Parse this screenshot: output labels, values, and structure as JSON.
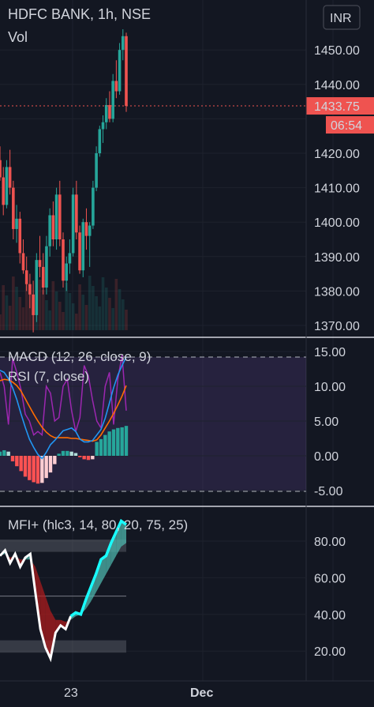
{
  "header": {
    "symbol_line": "HDFC BANK, 1h, NSE",
    "vol_label": "Vol",
    "currency_button": "INR"
  },
  "price_axis": {
    "ticks": [
      "1450.00",
      "1440.00",
      "1430.00",
      "1420.00",
      "1410.00",
      "1400.00",
      "1390.00",
      "1380.00",
      "1370.00"
    ],
    "last_price": "1433.75",
    "countdown": "06:54"
  },
  "macd_pane": {
    "legend_macd": "MACD (12, 26, close, 9)",
    "legend_rsi": "RSI (7, close)",
    "ticks": [
      "15.00",
      "10.00",
      "5.00",
      "0.00",
      "-5.00"
    ]
  },
  "mfi_pane": {
    "legend": "MFI+ (hlc3, 14, 80, 20, 75, 25)",
    "ticks": [
      "80.00",
      "60.00",
      "40.00",
      "20.00"
    ]
  },
  "time_axis": {
    "labels": [
      "23",
      "Dec"
    ]
  },
  "colors": {
    "background": "#131722",
    "up": "#26a69a",
    "down": "#ef5350",
    "macd_line": "#2196f3",
    "signal_line": "#ff6d00",
    "rsi_line": "#9c27b0",
    "mfi_line": "#ffffff",
    "mfi_cyan": "#18ffff"
  },
  "chart_data": [
    {
      "type": "candlestick",
      "title": "HDFC BANK, 1h, NSE",
      "ylim": [
        1367,
        1457
      ],
      "last_price": 1433.75,
      "candles": [
        [
          1418,
          1422,
          1412,
          1413
        ],
        [
          1413,
          1416,
          1402,
          1405
        ],
        [
          1405,
          1418,
          1404,
          1416
        ],
        [
          1416,
          1421,
          1408,
          1410
        ],
        [
          1410,
          1412,
          1395,
          1398
        ],
        [
          1398,
          1405,
          1394,
          1401
        ],
        [
          1401,
          1403,
          1388,
          1391
        ],
        [
          1391,
          1395,
          1385,
          1386
        ],
        [
          1386,
          1390,
          1380,
          1382
        ],
        [
          1382,
          1385,
          1375,
          1379
        ],
        [
          1379,
          1383,
          1368,
          1373
        ],
        [
          1373,
          1391,
          1371,
          1389
        ],
        [
          1389,
          1396,
          1384,
          1387
        ],
        [
          1387,
          1391,
          1379,
          1381
        ],
        [
          1381,
          1396,
          1379,
          1393
        ],
        [
          1393,
          1404,
          1390,
          1402
        ],
        [
          1402,
          1406,
          1393,
          1395
        ],
        [
          1395,
          1410,
          1392,
          1408
        ],
        [
          1408,
          1412,
          1393,
          1395
        ],
        [
          1395,
          1397,
          1381,
          1383
        ],
        [
          1383,
          1390,
          1380,
          1388
        ],
        [
          1388,
          1395,
          1385,
          1391
        ],
        [
          1391,
          1410,
          1390,
          1408
        ],
        [
          1408,
          1412,
          1395,
          1397
        ],
        [
          1397,
          1399,
          1385,
          1386
        ],
        [
          1386,
          1401,
          1384,
          1400
        ],
        [
          1400,
          1404,
          1392,
          1396
        ],
        [
          1396,
          1400,
          1387,
          1399
        ],
        [
          1399,
          1412,
          1398,
          1410
        ],
        [
          1410,
          1422,
          1409,
          1420
        ],
        [
          1420,
          1428,
          1419,
          1427
        ],
        [
          1427,
          1431,
          1423,
          1429
        ],
        [
          1429,
          1436,
          1427,
          1434
        ],
        [
          1434,
          1438,
          1429,
          1430
        ],
        [
          1430,
          1443,
          1429,
          1441
        ],
        [
          1441,
          1447,
          1436,
          1438
        ],
        [
          1438,
          1452,
          1437,
          1450
        ],
        [
          1450,
          1456,
          1447,
          1454
        ],
        [
          1454,
          1455,
          1432,
          1433.75
        ]
      ]
    },
    {
      "type": "line",
      "title": "MACD (12, 26, close, 9) / RSI (7, close)",
      "ylim": [
        -5.8,
        16
      ],
      "series": [
        {
          "name": "MACD",
          "values": [
            12.3,
            12.0,
            11.1,
            9.8,
            8.1,
            6.0,
            4.1,
            2.4,
            1.2,
            0.2,
            -0.4,
            0.5,
            1.6,
            2.2,
            2.9,
            3.6,
            3.8,
            4.0,
            3.5,
            2.4,
            2.0,
            2.0,
            2.2,
            3.0,
            3.8,
            5.4,
            7.6,
            9.8,
            11.6,
            13.0,
            14.2
          ]
        },
        {
          "name": "Signal",
          "values": [
            10.8,
            11.0,
            10.9,
            10.6,
            10.1,
            9.3,
            8.2,
            7.1,
            6.0,
            5.0,
            4.1,
            3.4,
            2.9,
            2.6,
            2.6,
            2.6,
            2.6,
            2.5,
            2.5,
            2.4,
            2.3,
            2.2,
            2.1,
            2.3,
            3.0,
            4.0,
            5.0,
            6.1,
            7.3,
            8.6,
            10.1
          ]
        },
        {
          "name": "RSI",
          "values": [
            12.0,
            10.0,
            4.5,
            14.0,
            12.0,
            9.5,
            6.0,
            5.0,
            3.0,
            3.5,
            3.0,
            10.0,
            9.0,
            5.0,
            5.5,
            10.0,
            11.0,
            6.5,
            3.5,
            5.5,
            13.0,
            11.5,
            8.0,
            5.0,
            4.0,
            10.0,
            12.0,
            4.5,
            11.0,
            14.5,
            6.5
          ]
        },
        {
          "name": "Histogram",
          "values": [
            0.6,
            0.8,
            0.6,
            -0.8,
            -1.5,
            -2.2,
            -3.0,
            -3.5,
            -3.8,
            -4.0,
            -3.9,
            -3.2,
            -2.4,
            -1.2,
            0.3,
            0.7,
            0.7,
            0.6,
            0.4,
            -0.2,
            -0.5,
            -0.6,
            -0.5,
            2.0,
            2.4,
            3.0,
            3.5,
            3.8,
            4.0,
            4.1,
            4.3
          ]
        }
      ]
    },
    {
      "type": "line",
      "title": "MFI+ (hlc3, 14, 80, 20, 75, 25)",
      "ylim": [
        12,
        94
      ],
      "series": [
        {
          "name": "MFI",
          "values": [
            72,
            75,
            68,
            73,
            66,
            71,
            73,
            52,
            32,
            22,
            16,
            30,
            34,
            32,
            39,
            41,
            40,
            48,
            55,
            62,
            70,
            72,
            79,
            85,
            91,
            89
          ]
        },
        {
          "name": "MFI smoothed",
          "values": [
            72,
            73,
            71,
            72,
            70,
            70,
            70,
            66,
            58,
            50,
            42,
            37,
            37,
            36,
            37,
            39,
            40,
            43,
            47,
            52,
            57,
            62,
            67,
            72,
            77,
            79
          ]
        }
      ],
      "bands": [
        75,
        80,
        50,
        20,
        25
      ]
    }
  ]
}
